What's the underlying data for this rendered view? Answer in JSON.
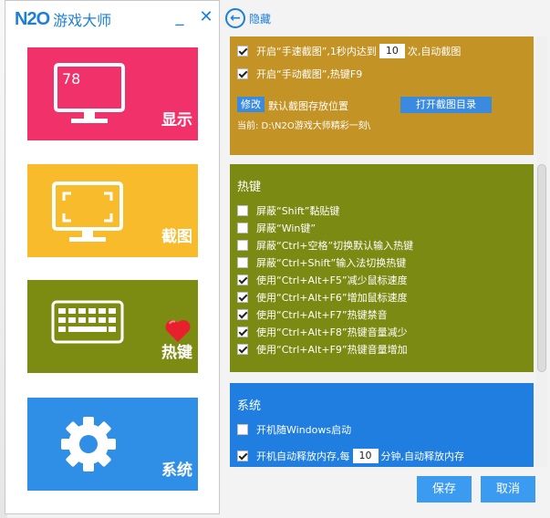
{
  "app": {
    "logo_mark": "N2O",
    "logo_name": "游戏大师",
    "minimize": "_",
    "close": "✕"
  },
  "back": {
    "label": "隐藏"
  },
  "sidebar": {
    "tiles": [
      {
        "label": "显示",
        "screen_value": "78",
        "color": "#f0316a"
      },
      {
        "label": "截图",
        "color": "#f8bb2c"
      },
      {
        "label": "热键",
        "color": "#7c8c13"
      },
      {
        "label": "系统",
        "color": "#2f8fe6"
      }
    ]
  },
  "screenshot": {
    "fast_capture": {
      "checked": true,
      "label_before": "开启“手速截图”,1秒内达到",
      "value": "10",
      "label_after": "次,自动截图"
    },
    "manual_capture": {
      "checked": true,
      "label": "开启“手动截图”,热键F9"
    },
    "modify_button": "修改",
    "save_location_label": "默认截图存放位置",
    "open_dir_button": "打开截图目录",
    "current_path": "当前: D:\\N2O游戏大师精彩一刻\\"
  },
  "hotkey": {
    "title": "热键",
    "items": [
      {
        "checked": false,
        "label": "屏蔽“Shift”黏贴键"
      },
      {
        "checked": false,
        "label": "屏蔽“Win键”"
      },
      {
        "checked": false,
        "label": "屏蔽“Ctrl+空格”切换默认输入热键"
      },
      {
        "checked": false,
        "label": "屏蔽“Ctrl+Shift”输入法切换热键"
      },
      {
        "checked": true,
        "label": "使用“Ctrl+Alt+F5”减少鼠标速度"
      },
      {
        "checked": true,
        "label": "使用“Ctrl+Alt+F6”增加鼠标速度"
      },
      {
        "checked": true,
        "label": "使用“Ctrl+Alt+F7”热键禁音"
      },
      {
        "checked": true,
        "label": "使用“Ctrl+Alt+F8”热键音量减少"
      },
      {
        "checked": true,
        "label": "使用“Ctrl+Alt+F9”热键音量增加"
      }
    ]
  },
  "system": {
    "title": "系统",
    "autostart": {
      "checked": false,
      "label": "开机随Windows启动"
    },
    "auto_release": {
      "checked": true,
      "label_before": "开机自动释放内存,每",
      "value": "10",
      "label_after": "分钟,自动释放内存"
    }
  },
  "footer": {
    "save": "保存",
    "cancel": "取消"
  },
  "colors": {
    "accent": "#1d7fd8",
    "screenshot_panel": "#c49326",
    "hotkey_panel": "#7b8a12",
    "system_panel": "#1f7ee0"
  }
}
